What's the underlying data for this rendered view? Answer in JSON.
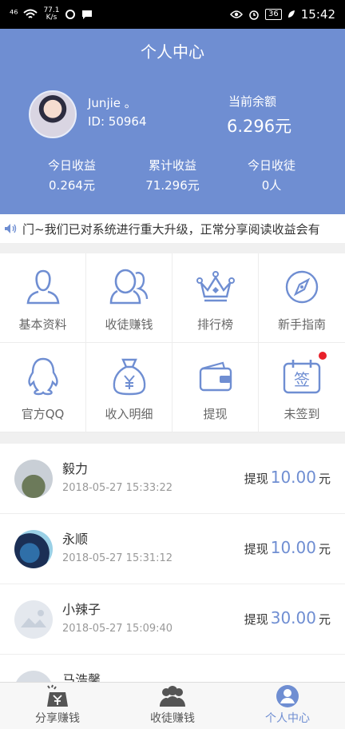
{
  "status_bar": {
    "signal": "⁴⁶",
    "net_speed_value": "77.1",
    "net_speed_unit": "K/s",
    "battery": "36",
    "time": "15:42"
  },
  "header": {
    "title": "个人中心",
    "user_name": "Junjie 。",
    "user_id": "ID: 50964",
    "balance_label": "当前余额",
    "balance_value": "6.296元",
    "stats": [
      {
        "label": "今日收益",
        "value": "0.264元"
      },
      {
        "label": "累计收益",
        "value": "71.296元"
      },
      {
        "label": "今日收徒",
        "value": "0人"
      }
    ]
  },
  "notice": {
    "text": "门~我们已对系统进行重大升级，正常分享阅读收益会有"
  },
  "menu": [
    {
      "label": "基本资料",
      "icon": "user-profile-icon"
    },
    {
      "label": "收徒赚钱",
      "icon": "group-users-icon"
    },
    {
      "label": "排行榜",
      "icon": "crown-icon"
    },
    {
      "label": "新手指南",
      "icon": "compass-icon"
    },
    {
      "label": "官方QQ",
      "icon": "qq-penguin-icon"
    },
    {
      "label": "收入明细",
      "icon": "money-bag-icon"
    },
    {
      "label": "提现",
      "icon": "wallet-icon"
    },
    {
      "label": "未签到",
      "icon": "calendar-sign-icon",
      "sign_char": "签"
    }
  ],
  "records": [
    {
      "name": "毅力",
      "time": "2018-05-27 15:33:22",
      "prefix": "提现",
      "amount": "10.00",
      "unit": "元"
    },
    {
      "name": "永顺",
      "time": "2018-05-27 15:31:12",
      "prefix": "提现",
      "amount": "10.00",
      "unit": "元"
    },
    {
      "name": "小辣子",
      "time": "2018-05-27 15:09:40",
      "prefix": "提现",
      "amount": "30.00",
      "unit": "元"
    },
    {
      "name": "马浩馨",
      "time": "",
      "prefix": "",
      "amount": "",
      "unit": ""
    }
  ],
  "tabs": [
    {
      "label": "分享赚钱",
      "icon": "share-money-icon"
    },
    {
      "label": "收徒赚钱",
      "icon": "group-users-icon"
    },
    {
      "label": "个人中心",
      "icon": "person-circle-icon"
    }
  ],
  "colors": {
    "accent": "#6f8ed2",
    "badge_red": "#e8202a"
  }
}
